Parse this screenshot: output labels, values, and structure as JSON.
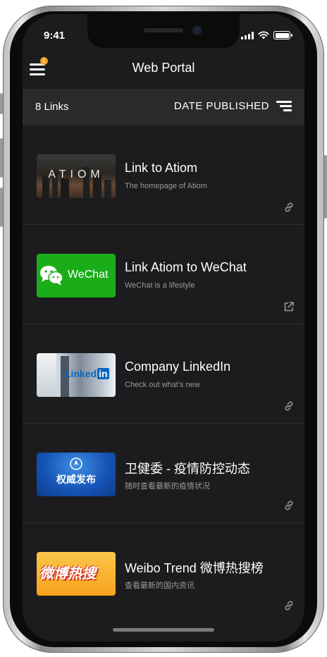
{
  "status_bar": {
    "time": "9:41"
  },
  "navbar": {
    "title": "Web Portal",
    "menu_badge": "1"
  },
  "toolbar": {
    "links_count": "8 Links",
    "sort_label": "DATE PUBLISHED"
  },
  "links": [
    {
      "title": "Link to Atiom",
      "subtitle": "The homepage of Atiom",
      "thumb_text": "ATIOM",
      "action_icon": "link-icon"
    },
    {
      "title": "Link Atiom to WeChat",
      "subtitle": "WeChat is a lifestyle",
      "thumb_text": "WeChat",
      "action_icon": "external-link-icon"
    },
    {
      "title": "Company LinkedIn",
      "subtitle": "Check out what's new",
      "thumb_text": "Linked",
      "thumb_text_2": "in",
      "action_icon": "link-icon"
    },
    {
      "title": "卫健委 - 疫情防控动态",
      "subtitle": "随时查看最新的疫情状况",
      "thumb_text": "权威发布",
      "action_icon": "link-icon"
    },
    {
      "title": "Weibo Trend 微博热搜榜",
      "subtitle": "查看最新的国内资讯",
      "thumb_text": "微博热搜",
      "action_icon": "link-icon"
    }
  ],
  "colors": {
    "background": "#1c1c1e",
    "toolbar": "#2a2a2c",
    "wechat_green": "#1aad19",
    "badge": "#f0a020",
    "weibo_orange": "#f7a21b"
  }
}
